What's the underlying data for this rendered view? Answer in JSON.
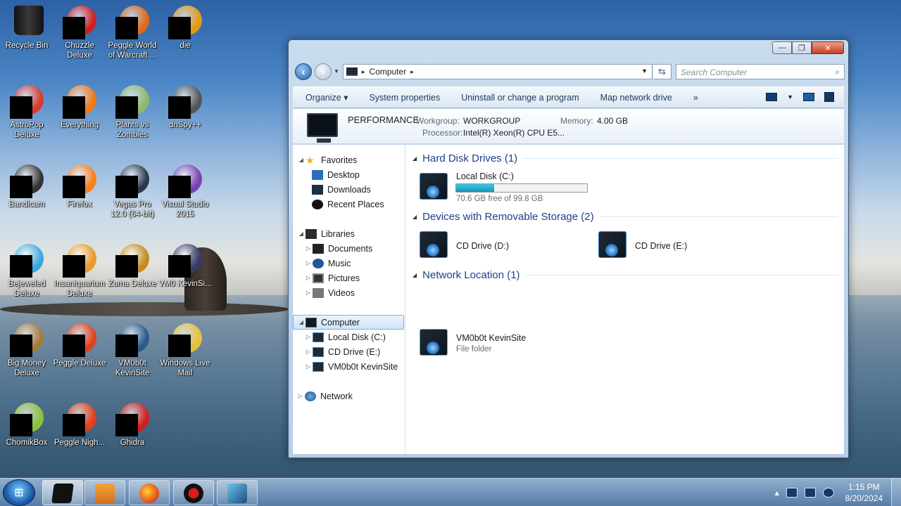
{
  "desktop": {
    "icons": [
      {
        "label": "Recycle Bin",
        "color": "#1c1c1c"
      },
      {
        "label": "Chuzzle Deluxe",
        "color": "#d12020"
      },
      {
        "label": "Peggle World of Warcraft ...",
        "color": "#e06a1a"
      },
      {
        "label": "die",
        "color": "#e39b12"
      },
      {
        "label": "AstroPop Deluxe",
        "color": "#d83a2c"
      },
      {
        "label": "Everything",
        "color": "#f07a12"
      },
      {
        "label": "Plants vs Zombies",
        "color": "#8fb86a"
      },
      {
        "label": "dnSpy++",
        "color": "#555555"
      },
      {
        "label": "Bandicam",
        "color": "#333333"
      },
      {
        "label": "Firefox",
        "color": "#f5801e"
      },
      {
        "label": "Vegas Pro 12.0 (64-bit)",
        "color": "#2a3a4a"
      },
      {
        "label": "Visual Studio 2015",
        "color": "#7b3fb2"
      },
      {
        "label": "Bejeweled Deluxe",
        "color": "#3aa7e0"
      },
      {
        "label": "Insaniquarium Deluxe",
        "color": "#e89a2a"
      },
      {
        "label": "Zuma Deluxe",
        "color": "#c28c22"
      },
      {
        "label": "VM0 KevinSi...",
        "color": "#3a3a6a"
      },
      {
        "label": "Big Money Deluxe",
        "color": "#a67a3a"
      },
      {
        "label": "Peggle Deluxe",
        "color": "#e2401c"
      },
      {
        "label": "VM0b0t KevinSite",
        "color": "#2b5a8a"
      },
      {
        "label": "Windows Live Mail",
        "color": "#e6c23a"
      },
      {
        "label": "ChomikBox",
        "color": "#8ac43a"
      },
      {
        "label": "Peggle Nigh...",
        "color": "#e2401c"
      },
      {
        "label": "Ghidra",
        "color": "#d11e1e"
      }
    ]
  },
  "window": {
    "controls": {
      "minimize": "—",
      "maximize": "❐",
      "close": "✕"
    },
    "address": {
      "location": "Computer",
      "separator": "▸"
    },
    "search": {
      "placeholder": "Search Computer"
    },
    "commands": {
      "organize": "Organize ▾",
      "system_properties": "System properties",
      "uninstall": "Uninstall or change a program",
      "map_network": "Map network drive",
      "more": "»"
    },
    "details": {
      "computer_name": "PERFORMANCE",
      "workgroup_label": "Workgroup:",
      "workgroup_value": "WORKGROUP",
      "memory_label": "Memory:",
      "memory_value": "4.00 GB",
      "processor_label": "Processor:",
      "processor_value": "Intel(R) Xeon(R) CPU E5..."
    },
    "nav": {
      "favorites": "Favorites",
      "desktop": "Desktop",
      "downloads": "Downloads",
      "recent_places": "Recent Places",
      "libraries": "Libraries",
      "documents": "Documents",
      "music": "Music",
      "pictures": "Pictures",
      "videos": "Videos",
      "computer": "Computer",
      "local_disk": "Local Disk (C:)",
      "cd_drive": "CD Drive (E:)",
      "vm_site": "VM0b0t KevinSite",
      "network": "Network"
    },
    "groups": {
      "hard_disks": "Hard Disk Drives (1)",
      "removable": "Devices with Removable Storage (2)",
      "network": "Network Location (1)"
    },
    "items": {
      "local_disk_name": "Local Disk (C:)",
      "local_disk_free": "70.6 GB free of 99.8 GB",
      "local_disk_used_fraction": 0.29,
      "cd_d": "CD Drive (D:)",
      "cd_e": "CD Drive (E:)",
      "net_name": "VM0b0t KevinSite",
      "net_type": "File folder"
    }
  },
  "taskbar": {
    "start_label": "⊞",
    "time": "1:15 PM",
    "date": "8/20/2024",
    "tray_arrow": "▴"
  }
}
